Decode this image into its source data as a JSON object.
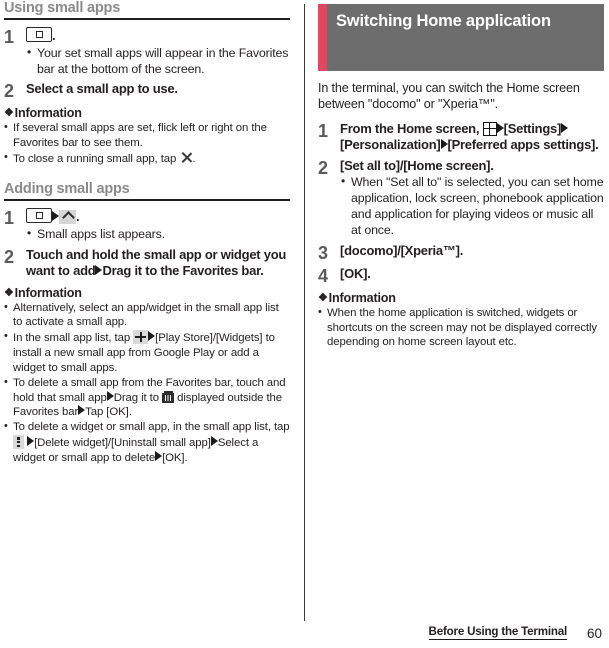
{
  "document": {
    "footer_chapter": "Before Using the Terminal",
    "page_number": "60"
  },
  "left_column": {
    "section1": {
      "heading": "Using small apps",
      "steps": [
        {
          "number": "1",
          "title_suffix": ".",
          "icons": [
            "recent-apps-key"
          ],
          "bullets": [
            "Your set small apps will appear in the Favorites bar at the bottom of the screen."
          ]
        },
        {
          "number": "2",
          "title": "Select a small app to use.",
          "bullets": []
        }
      ],
      "information": {
        "heading": "Information",
        "items": [
          "If several small apps are set, flick left or right on the Favorites bar to see them.",
          "To close a running small app, tap"
        ],
        "item2_tail": "."
      }
    },
    "section2": {
      "heading": "Adding small apps",
      "steps": [
        {
          "number": "1",
          "title_suffix": ".",
          "icons": [
            "recent-apps-key",
            "arrow",
            "caret-up"
          ],
          "bullets": [
            "Small apps list appears."
          ]
        },
        {
          "number": "2",
          "title_part1": "Touch and hold the small app or widget you want to add",
          "title_part2": "Drag it to the Favorites bar.",
          "bullets": []
        }
      ],
      "information": {
        "heading": "Information",
        "items": [
          {
            "id": "alternatively",
            "text": "Alternatively, select an app/widget in the small app list to activate a small app."
          },
          {
            "id": "play-store",
            "pre": "In the small app list, tap",
            "mid": "[Play Store]/[Widgets]",
            "post": "to install a new small app from Google Play or add a widget to small apps."
          },
          {
            "id": "delete-small-app",
            "pre": "To delete a small app from the Favorites bar, touch and hold that small app",
            "mid1": "Drag it to",
            "mid2": "displayed outside the Favorites bar",
            "post": "Tap [OK]."
          },
          {
            "id": "delete-widget",
            "pre": "To delete a widget or small app, in the small app list, tap",
            "mid1": "[Delete widget]/[Uninstall small app]",
            "mid2": "Select a widget or small app to delete",
            "post": "[OK]."
          }
        ]
      }
    }
  },
  "right_column": {
    "banner_title": "Switching Home application",
    "banner_accent_color": "#e1475f",
    "banner_bg_color": "#6d6d6d",
    "intro": "In the terminal, you can switch the Home screen between \"docomo\" or \"Xperia™\".",
    "steps": [
      {
        "number": "1",
        "title_part1": "From the Home screen,",
        "title_part2": "[Settings]",
        "title_part3": "[Personalization]",
        "title_part4": "[Preferred apps settings].",
        "bullets": []
      },
      {
        "number": "2",
        "title": "[Set all to]/[Home screen].",
        "bullets": [
          "When \"Set all to\" is selected, you can set home application, lock screen, phonebook application and application for playing videos or music all at once."
        ]
      },
      {
        "number": "3",
        "title": "[docomo]/[Xperia™].",
        "bullets": []
      },
      {
        "number": "4",
        "title": "[OK].",
        "bullets": []
      }
    ],
    "information": {
      "heading": "Information",
      "items": [
        "When the home application is switched, widgets or shortcuts on the screen may not be displayed correctly depending on home screen layout etc."
      ]
    }
  }
}
